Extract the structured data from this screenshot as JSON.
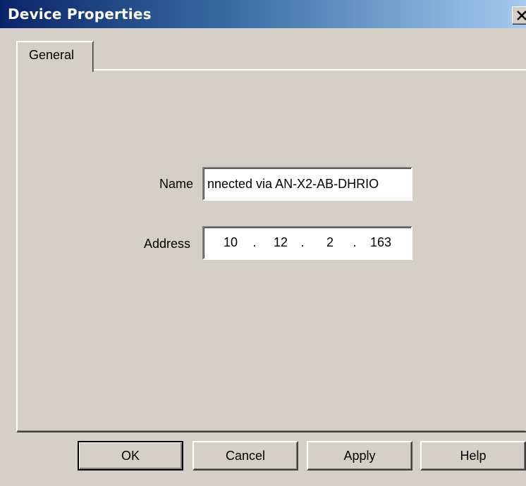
{
  "window": {
    "title": "Device Properties",
    "close_label": "X"
  },
  "tabs": [
    {
      "label": "General",
      "selected": true
    }
  ],
  "fields": {
    "name_label": "Name",
    "name_value": "nnected via AN-X2-AB-DHRIO",
    "address_label": "Address",
    "address_octets": [
      "10",
      "12",
      "2",
      "163"
    ],
    "address_separator": "."
  },
  "buttons": {
    "ok": "OK",
    "cancel": "Cancel",
    "apply": "Apply",
    "help": "Help"
  },
  "colors": {
    "title_bar_start": "#0a246a",
    "title_bar_end": "#a6caf0",
    "dialog_face": "#d4d0c8"
  }
}
